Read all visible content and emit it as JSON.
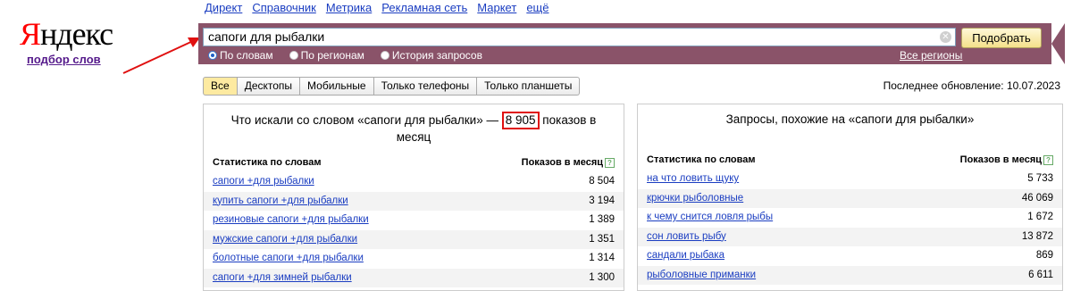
{
  "logo": {
    "first_letter": "Я",
    "rest": "ндекс",
    "subtitle": "подбор слов"
  },
  "topnav": [
    "Директ",
    "Справочник",
    "Метрика",
    "Рекламная сеть",
    "Маркет",
    "ещё"
  ],
  "search": {
    "value": "сапоги для рыбалки",
    "button": "Подобрать"
  },
  "modes": [
    {
      "label": "По словам",
      "selected": true
    },
    {
      "label": "По регионам",
      "selected": false
    },
    {
      "label": "История запросов",
      "selected": false
    }
  ],
  "regions_link": "Все регионы",
  "tabs": [
    "Все",
    "Десктопы",
    "Мобильные",
    "Только телефоны",
    "Только планшеты"
  ],
  "updated": "Последнее обновление: 10.07.2023",
  "left_panel": {
    "title_before": "Что искали со словом «сапоги для рыбалки» —",
    "total": "8 905",
    "title_after": "показов в месяц",
    "col_words": "Статистика по словам",
    "col_count": "Показов в месяц",
    "rows": [
      {
        "phrase": "сапоги +для рыбалки",
        "count": "8 504"
      },
      {
        "phrase": "купить сапоги +для рыбалки",
        "count": "3 194"
      },
      {
        "phrase": "резиновые сапоги +для рыбалки",
        "count": "1 389"
      },
      {
        "phrase": "мужские сапоги +для рыбалки",
        "count": "1 351"
      },
      {
        "phrase": "болотные сапоги +для рыбалки",
        "count": "1 314"
      },
      {
        "phrase": "сапоги +для зимней рыбалки",
        "count": "1 300"
      }
    ]
  },
  "right_panel": {
    "title": "Запросы, похожие на «сапоги для рыбалки»",
    "col_words": "Статистика по словам",
    "col_count": "Показов в месяц",
    "rows": [
      {
        "phrase": "на что ловить щуку",
        "count": "5 733"
      },
      {
        "phrase": "крючки рыболовные",
        "count": "46 069"
      },
      {
        "phrase": "к чему снится ловля рыбы",
        "count": "1 672"
      },
      {
        "phrase": "сон ловить рыбу",
        "count": "13 872"
      },
      {
        "phrase": "сандали рыбака",
        "count": "869"
      },
      {
        "phrase": "рыболовные приманки",
        "count": "6 611"
      }
    ]
  },
  "colors": {
    "band": "#8a5369",
    "link": "#1a3dc1",
    "highlight": "#e01010",
    "brand_red": "#ff0000"
  }
}
